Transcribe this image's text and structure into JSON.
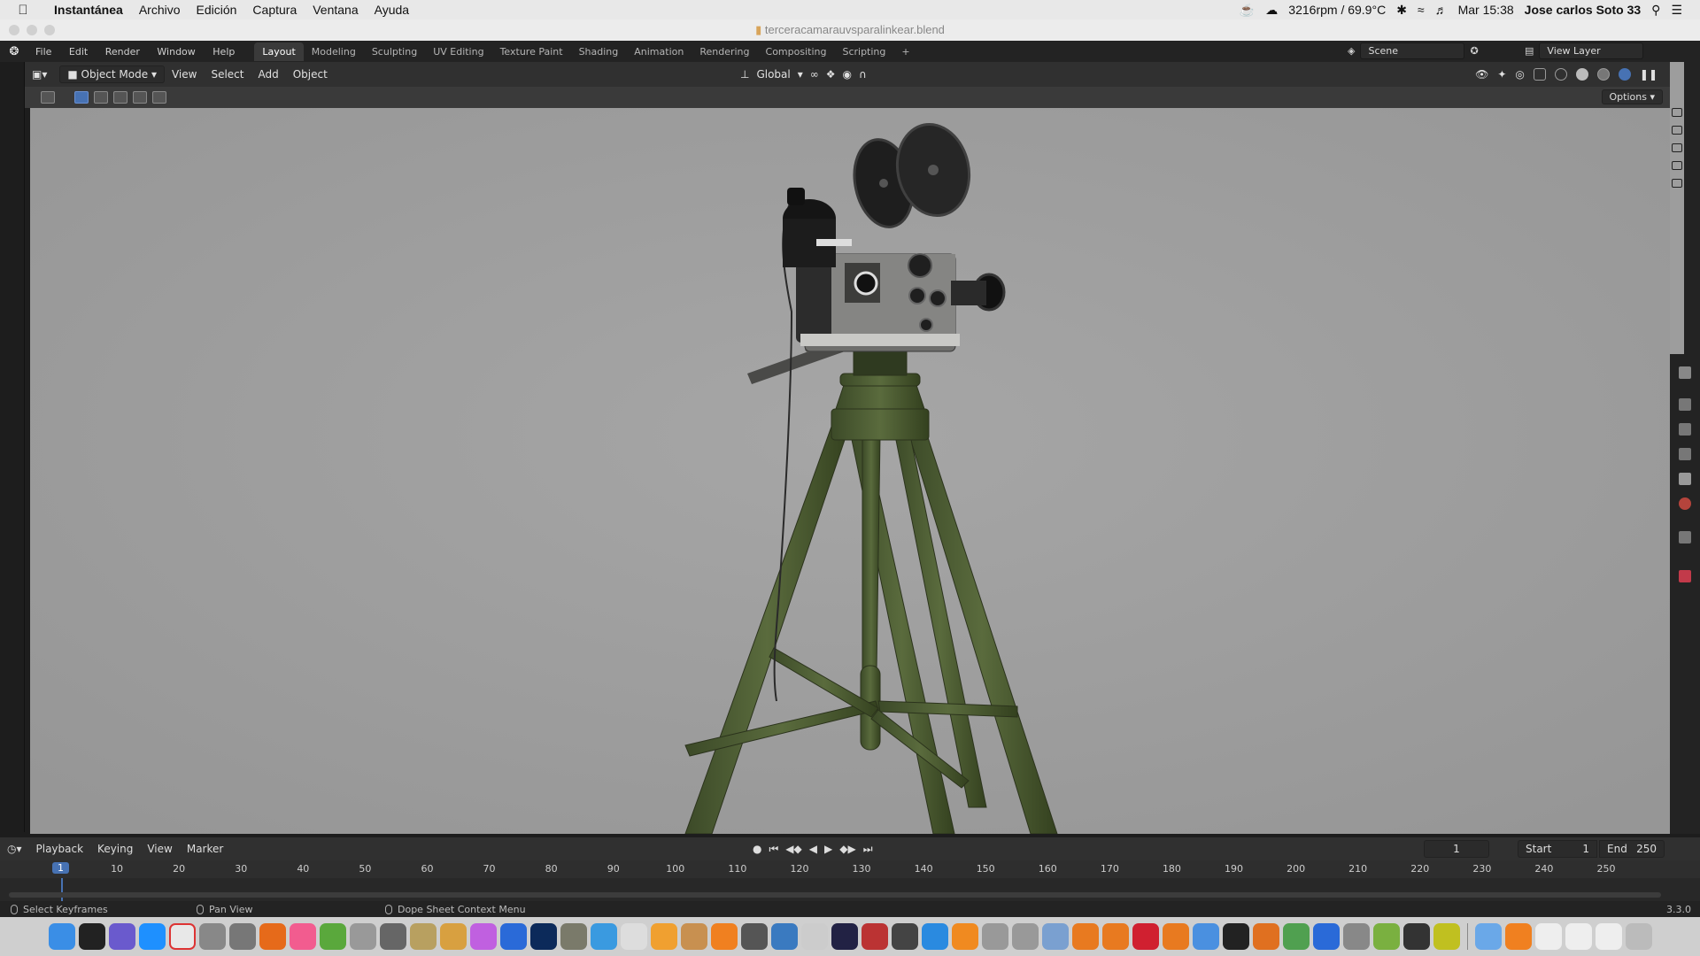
{
  "mac_menu": {
    "app": "Instantánea",
    "items": [
      "Archivo",
      "Edición",
      "Captura",
      "Ventana",
      "Ayuda"
    ],
    "status_fan": "3216rpm / 69.9°C",
    "clock": "Mar 15:38",
    "user": "Jose carlos Soto 33"
  },
  "window": {
    "title": "terceracamarauvsparalinkear.blend"
  },
  "blender_menu": [
    "File",
    "Edit",
    "Render",
    "Window",
    "Help"
  ],
  "workspaces": {
    "active": "Layout",
    "tabs": [
      "Layout",
      "Modeling",
      "Sculpting",
      "UV Editing",
      "Texture Paint",
      "Shading",
      "Animation",
      "Rendering",
      "Compositing",
      "Scripting",
      "+"
    ]
  },
  "scene": {
    "name": "Scene",
    "view_layer": "View Layer"
  },
  "viewport_header": {
    "mode": "Object Mode",
    "menus": [
      "View",
      "Select",
      "Add",
      "Object"
    ],
    "transform_orientation": "Global",
    "options": "Options"
  },
  "timeline": {
    "menus": [
      "Playback",
      "Keying",
      "View",
      "Marker"
    ],
    "current_frame": "1",
    "start_label": "Start",
    "start_value": "1",
    "end_label": "End",
    "end_value": "250",
    "ruler": [
      "1",
      "10",
      "20",
      "30",
      "40",
      "50",
      "60",
      "70",
      "80",
      "90",
      "100",
      "110",
      "120",
      "130",
      "140",
      "150",
      "160",
      "170",
      "180",
      "190",
      "200",
      "210",
      "220",
      "230",
      "240",
      "250"
    ]
  },
  "statusbar": {
    "left": "Select Keyframes",
    "middle": "Pan View",
    "right": "Dope Sheet Context Menu",
    "version": "3.3.0"
  },
  "colors": {
    "accent": "#4772b3",
    "viewport_bg": "#9d9d9d",
    "tripod_green": "#4a5a33"
  }
}
